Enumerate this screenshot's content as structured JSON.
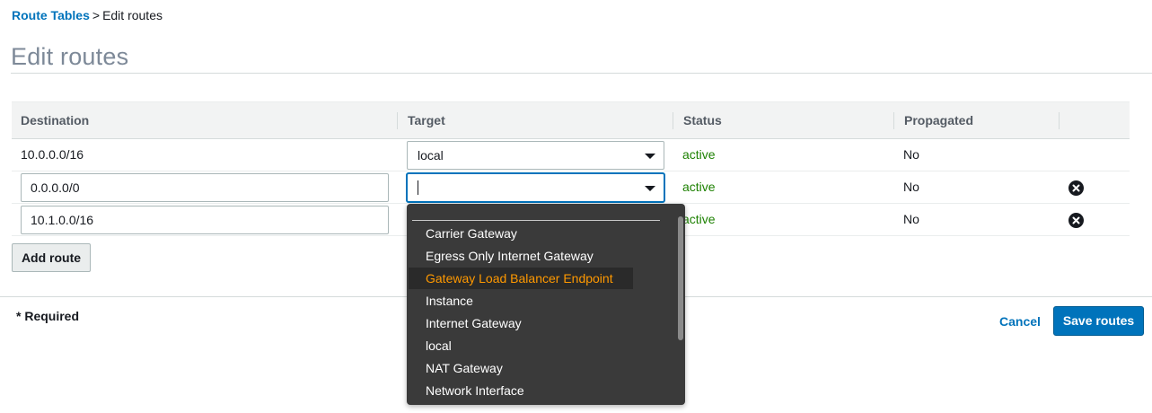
{
  "breadcrumb": {
    "parent": "Route Tables",
    "separator": ">",
    "current": "Edit routes"
  },
  "page_title": "Edit routes",
  "table": {
    "headers": {
      "destination": "Destination",
      "target": "Target",
      "status": "Status",
      "propagated": "Propagated"
    },
    "rows": [
      {
        "destination": "10.0.0.0/16",
        "target": "local",
        "status": "active",
        "propagated": "No",
        "editable": false,
        "removable": false
      },
      {
        "destination": "0.0.0.0/0",
        "target": "",
        "status": "active",
        "propagated": "No",
        "editable": true,
        "removable": true
      },
      {
        "destination": "10.1.0.0/16",
        "target": "",
        "status": "active",
        "propagated": "No",
        "editable": true,
        "removable": true
      }
    ]
  },
  "add_route_label": "Add route",
  "required_note": "* Required",
  "cancel_label": "Cancel",
  "save_label": "Save routes",
  "target_dropdown": {
    "options": [
      "Carrier Gateway",
      "Egress Only Internet Gateway",
      "Gateway Load Balancer Endpoint",
      "Instance",
      "Internet Gateway",
      "local",
      "NAT Gateway",
      "Network Interface"
    ],
    "highlighted": "Gateway Load Balancer Endpoint"
  },
  "icons": {
    "remove": "close-circle-icon",
    "caret": "chevron-down-icon"
  },
  "colors": {
    "link": "#0073bb",
    "status_active": "#1d8102",
    "primary_button": "#0073bb",
    "dropdown_highlight": "#ff9900",
    "dropdown_bg": "#3a3a3a"
  }
}
